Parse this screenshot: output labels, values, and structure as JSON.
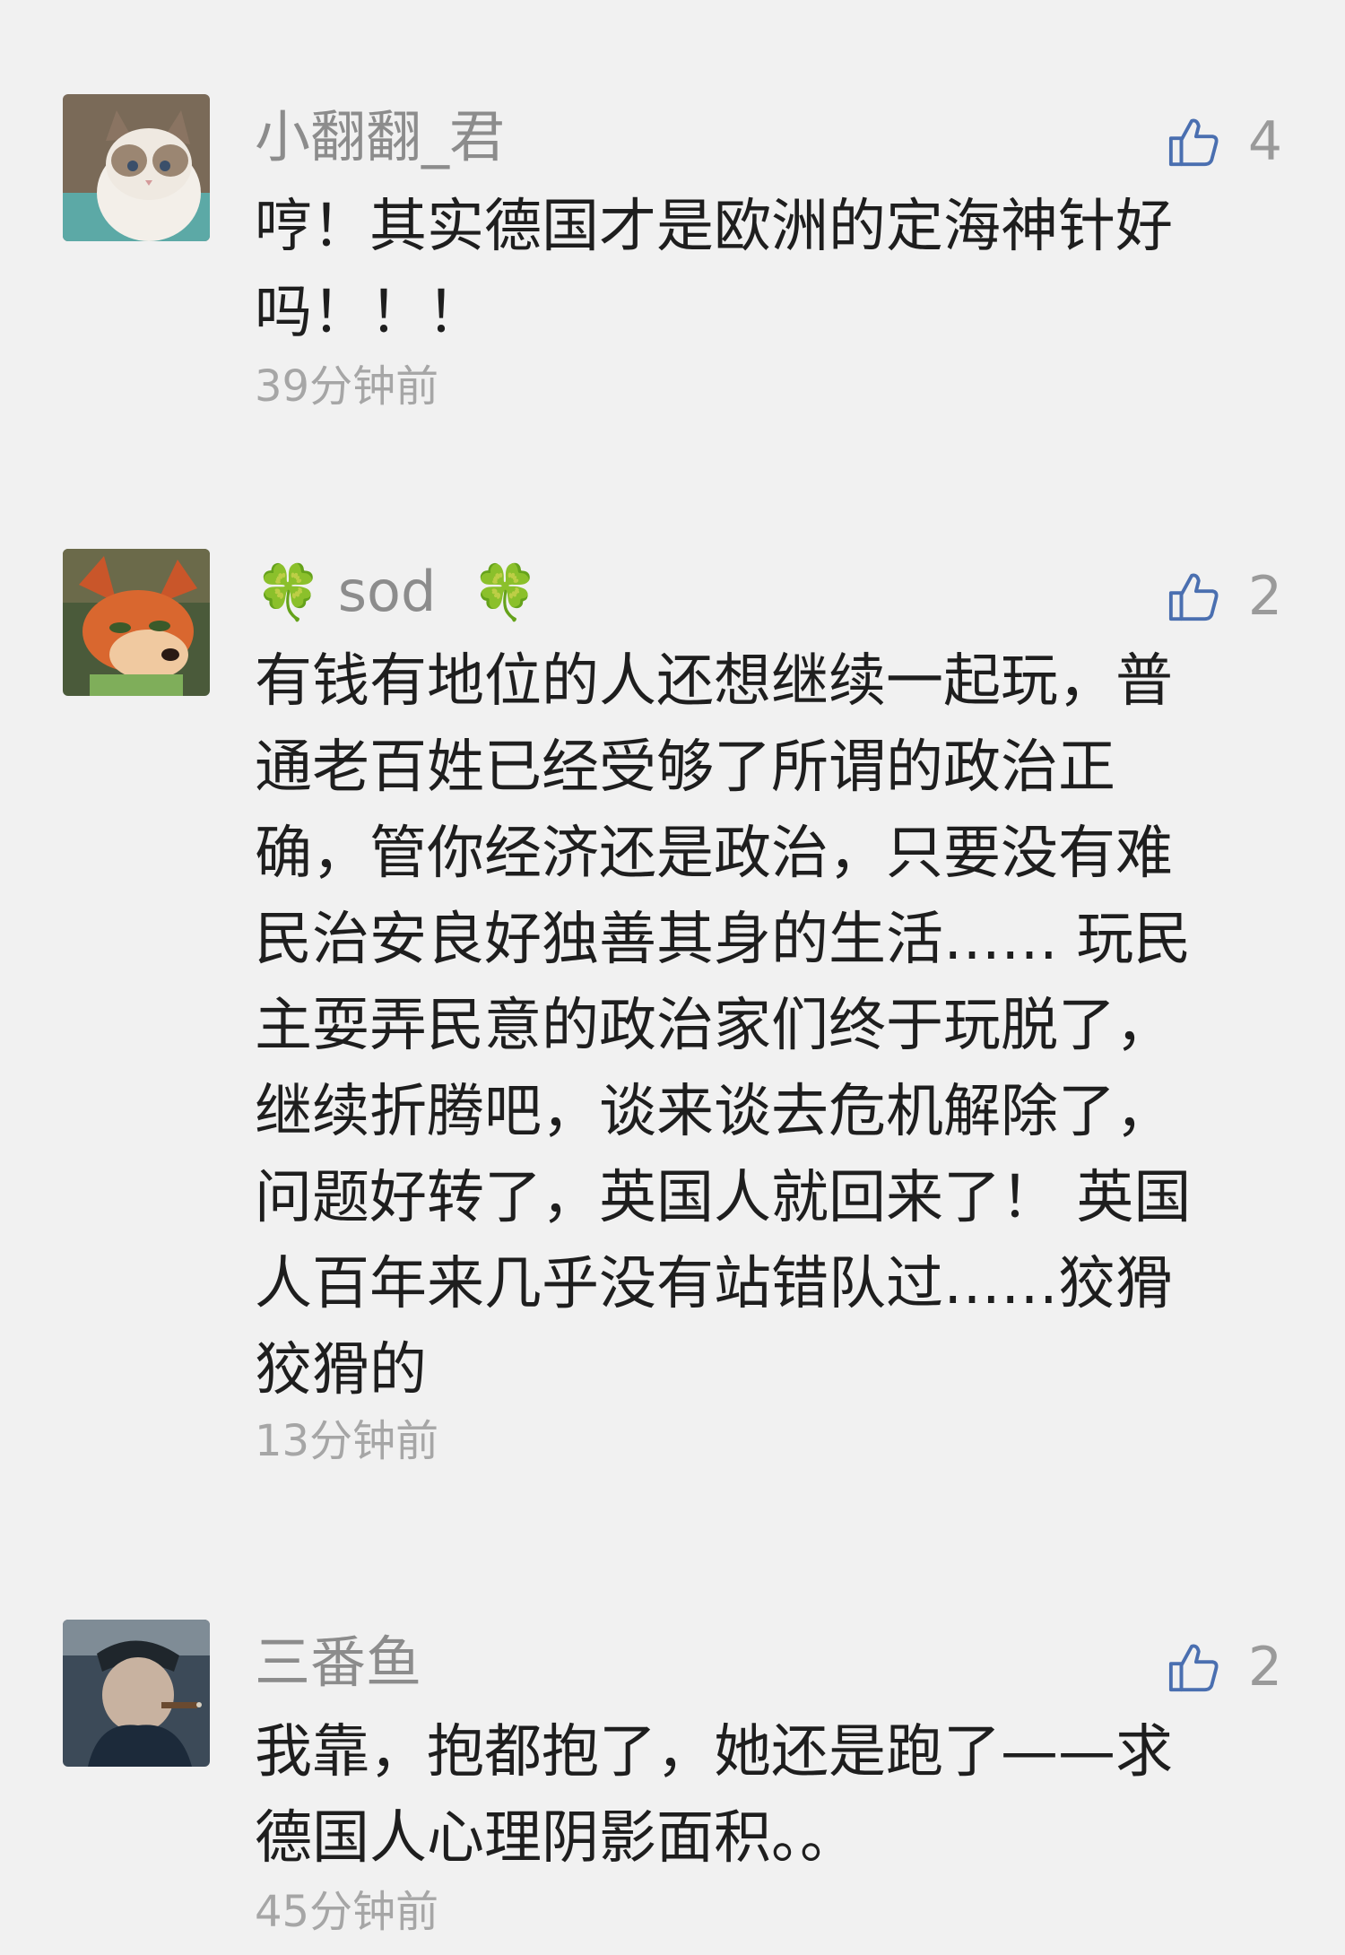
{
  "comments": [
    {
      "avatar_icon": "cat-avatar-icon",
      "username": "小翻翻_君",
      "likes": "4",
      "like_icon": "thumbs-up-icon",
      "lines": [
        "哼！其实德国才是欧洲的定海神针好",
        "吗！！！"
      ],
      "time": "39分钟前"
    },
    {
      "avatar_icon": "fox-avatar-icon",
      "username_prefix_icon": "🍀",
      "username": "sod",
      "username_suffix_icon": "🍀",
      "likes": "2",
      "like_icon": "thumbs-up-icon",
      "lines": [
        "有钱有地位的人还想继续一起玩，普",
        "通老百姓已经受够了所谓的政治正",
        "确，管你经济还是政治，只要没有难",
        "民治安良好独善其身的生活…… 玩民",
        "主耍弄民意的政治家们终于玩脱了，",
        "继续折腾吧，谈来谈去危机解除了，",
        "问题好转了，英国人就回来了！ 英国",
        "人百年来几乎没有站错队过……狡猾",
        "狡猾的"
      ],
      "time": "13分钟前"
    },
    {
      "avatar_icon": "man-with-cigar-avatar-icon",
      "username": "三番鱼",
      "likes": "2",
      "like_icon": "thumbs-up-icon",
      "lines": [
        "我靠，抱都抱了，她还是跑了——求",
        "德国人心理阴影面积。。"
      ],
      "time": "45分钟前"
    }
  ],
  "colors": {
    "background": "#f1f1f1",
    "username": "#8c8c8c",
    "body_text": "#1e1e1e",
    "timestamp": "#a6a6a6",
    "like_icon": "#4a6fb0",
    "clover": "#2fae4e"
  }
}
